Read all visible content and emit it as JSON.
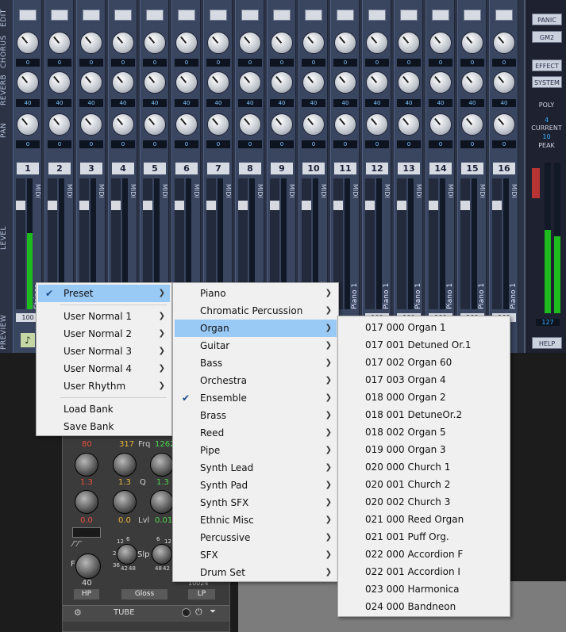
{
  "side_labels": {
    "edit": "EDIT",
    "chorus": "CHORUS",
    "reverb": "REVERB",
    "pan": "PAN",
    "level": "LEVEL",
    "preview": "PREVIEW"
  },
  "channels": [
    {
      "num": "1",
      "chorus": "0",
      "reverb": "40",
      "pan": "0",
      "midi": "MIDI",
      "preset": "Strings",
      "vol": "100"
    },
    {
      "num": "2",
      "chorus": "0",
      "reverb": "40",
      "pan": "0",
      "midi": "MIDI",
      "preset": "",
      "vol": ""
    },
    {
      "num": "3",
      "chorus": "0",
      "reverb": "40",
      "pan": "0",
      "midi": "MIDI",
      "preset": "",
      "vol": ""
    },
    {
      "num": "4",
      "chorus": "0",
      "reverb": "40",
      "pan": "0",
      "midi": "MIDI",
      "preset": "",
      "vol": ""
    },
    {
      "num": "5",
      "chorus": "0",
      "reverb": "40",
      "pan": "0",
      "midi": "MIDI",
      "preset": "",
      "vol": ""
    },
    {
      "num": "6",
      "chorus": "0",
      "reverb": "40",
      "pan": "0",
      "midi": "MIDI",
      "preset": "",
      "vol": ""
    },
    {
      "num": "7",
      "chorus": "0",
      "reverb": "40",
      "pan": "0",
      "midi": "MIDI",
      "preset": "",
      "vol": ""
    },
    {
      "num": "8",
      "chorus": "0",
      "reverb": "40",
      "pan": "0",
      "midi": "MIDI",
      "preset": "",
      "vol": ""
    },
    {
      "num": "9",
      "chorus": "0",
      "reverb": "40",
      "pan": "0",
      "midi": "MIDI",
      "preset": "",
      "vol": ""
    },
    {
      "num": "10",
      "chorus": "0",
      "reverb": "40",
      "pan": "0",
      "midi": "MIDI",
      "preset": "lard Set",
      "vol": ""
    },
    {
      "num": "11",
      "chorus": "0",
      "reverb": "40",
      "pan": "0",
      "midi": "MIDI",
      "preset": "Piano 1",
      "vol": ""
    },
    {
      "num": "12",
      "chorus": "0",
      "reverb": "40",
      "pan": "0",
      "midi": "MIDI",
      "preset": "Piano 1",
      "vol": "100"
    },
    {
      "num": "13",
      "chorus": "0",
      "reverb": "40",
      "pan": "0",
      "midi": "MIDI",
      "preset": "Piano 1",
      "vol": "100"
    },
    {
      "num": "14",
      "chorus": "0",
      "reverb": "40",
      "pan": "0",
      "midi": "MIDI",
      "preset": "Piano 1",
      "vol": "100"
    },
    {
      "num": "15",
      "chorus": "0",
      "reverb": "40",
      "pan": "0",
      "midi": "MIDI",
      "preset": "Piano 1",
      "vol": "100"
    },
    {
      "num": "16",
      "chorus": "0",
      "reverb": "40",
      "pan": "0",
      "midi": "MIDI",
      "preset": "Piano 1",
      "vol": "100"
    }
  ],
  "right_panel": {
    "panic": "PANIC",
    "gm2": "GM2",
    "effect": "EFFECT",
    "system": "SYSTEM",
    "poly": "POLY",
    "poly_val": "4",
    "current": "CURRENT",
    "current_val": "10",
    "peak": "PEAK",
    "master_vol": "127",
    "help": "HELP"
  },
  "device": {
    "v80": "80",
    "v317": "317",
    "frq": "Frq",
    "v1262": "1262",
    "v13a": "1.3",
    "v13b": "1.3",
    "q": "Q",
    "v13c": "1.3",
    "v00a": "0.0",
    "v00b": "0.0",
    "lvl": "Lvl",
    "v001": "0.01",
    "f": "F",
    "v40": "40",
    "slp": "Slp",
    "s12": "12",
    "s6": "6",
    "s24": "24",
    "s36": "36",
    "s42": "42",
    "s48": "48",
    "s6b": "6",
    "s12b": "12",
    "s48b": "48",
    "s42b": "42",
    "hp": "HP",
    "gloss": "Gloss",
    "lp": "LP",
    "v10024": "10024",
    "tube": "TUBE"
  },
  "menu1": {
    "items": [
      {
        "label": "Preset",
        "checked": true,
        "sub": true
      },
      {
        "label": "User Normal 1",
        "sub": true
      },
      {
        "label": "User Normal 2",
        "sub": true
      },
      {
        "label": "User Normal 3",
        "sub": true
      },
      {
        "label": "User Normal 4",
        "sub": true
      },
      {
        "label": "User Rhythm",
        "sub": true
      },
      {
        "label": "Load Bank"
      },
      {
        "label": "Save Bank"
      }
    ]
  },
  "menu2": {
    "items": [
      {
        "label": "Piano"
      },
      {
        "label": "Chromatic Percussion"
      },
      {
        "label": "Organ"
      },
      {
        "label": "Guitar"
      },
      {
        "label": "Bass"
      },
      {
        "label": "Orchestra"
      },
      {
        "label": "Ensemble",
        "checked": true
      },
      {
        "label": "Brass"
      },
      {
        "label": "Reed"
      },
      {
        "label": "Pipe"
      },
      {
        "label": "Synth Lead"
      },
      {
        "label": "Synth Pad"
      },
      {
        "label": "Synth SFX"
      },
      {
        "label": "Ethnic Misc"
      },
      {
        "label": "Percussive"
      },
      {
        "label": "SFX"
      },
      {
        "label": "Drum Set"
      }
    ]
  },
  "menu3": {
    "items": [
      "017 000 Organ 1",
      "017 001 Detuned Or.1",
      "017 002 Organ 60",
      "017 003 Organ 4",
      "018 000 Organ 2",
      "018 001 DetuneOr.2",
      "018 002 Organ 5",
      "019 000 Organ 3",
      "020 000 Church 1",
      "020 001 Church 2",
      "020 002 Church 3",
      "021 000 Reed Organ",
      "021 001 Puff Org.",
      "022 000 Accordion F",
      "022 001 Accordion I",
      "023 000 Harmonica",
      "024 000 Bandneon"
    ]
  },
  "colors": {
    "menu_highlight": "#99c9f5",
    "meter": "#1dbb1d",
    "panel": "#2b3345"
  }
}
